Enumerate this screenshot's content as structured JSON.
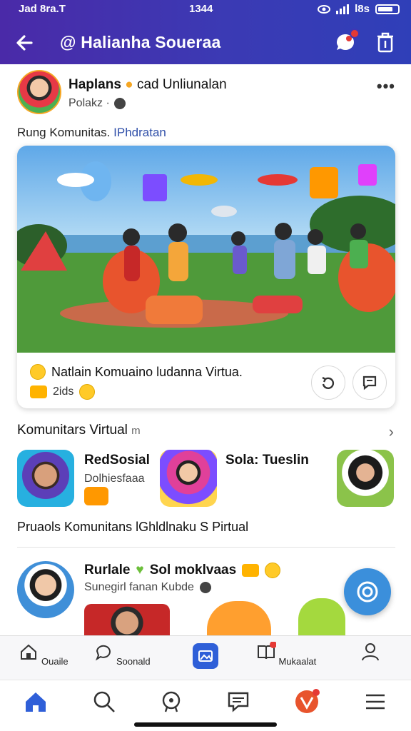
{
  "status": {
    "time_left": "Jad 8ra.T",
    "time_center": "1344",
    "battery_text": "l8s"
  },
  "header": {
    "title": "@ Halianha Soueraa"
  },
  "post": {
    "author": "Haplans",
    "author_rest": "cad Unliunalan",
    "meta": "Polakz ·",
    "caption_prefix": "Rung Komunitas.",
    "caption_link": "IPhdratan",
    "card_title": "Natlain Komuaino ludanna Virtua.",
    "card_count": "2ids"
  },
  "communities": {
    "title": "Komunitars Virtual",
    "title_tag": "m",
    "items": [
      {
        "name": "RedSosial",
        "sub": "Dolhiesfaaa"
      },
      {
        "name": "Sola: Tueslin",
        "sub": ""
      },
      {
        "name": "",
        "sub": ""
      }
    ]
  },
  "section2": {
    "title": "Pruaols Komunitans lGhldlnaku S Pirtual"
  },
  "post2": {
    "name": "Rurlale",
    "name_rest": "Sol moklvaas",
    "sub": "Sunegirl fanan Kubde"
  },
  "tabs_top": [
    {
      "label": "Ouaile"
    },
    {
      "label": "Soonald"
    },
    {
      "label": ""
    },
    {
      "label": "Mukaalat"
    },
    {
      "label": ""
    }
  ],
  "colors": {
    "header_start": "#4a2aa8",
    "header_end": "#2f3fb8",
    "accent_blue": "#2f5fd8",
    "badge_red": "#e53935"
  }
}
